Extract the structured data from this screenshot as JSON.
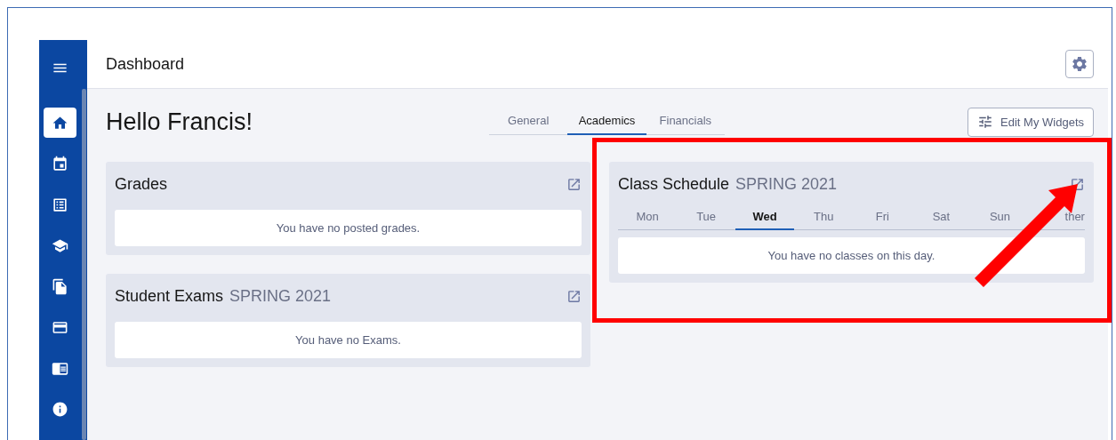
{
  "sidebar": {
    "menu": {
      "kind": "menu"
    },
    "items": [
      {
        "kind": "home",
        "selected": true
      },
      {
        "kind": "calendar",
        "selected": false
      },
      {
        "kind": "list",
        "selected": false
      },
      {
        "kind": "school",
        "selected": false
      },
      {
        "kind": "documents",
        "selected": false
      },
      {
        "kind": "card",
        "selected": false
      },
      {
        "kind": "book",
        "selected": false
      },
      {
        "kind": "info",
        "selected": false
      }
    ]
  },
  "header": {
    "title": "Dashboard"
  },
  "greeting": "Hello Francis!",
  "tabs": [
    {
      "label": "General",
      "selected": false
    },
    {
      "label": "Academics",
      "selected": true
    },
    {
      "label": "Financials",
      "selected": false
    }
  ],
  "edit_button": "Edit My Widgets",
  "left_widgets": [
    {
      "title": "Grades",
      "message": "You have no posted grades."
    },
    {
      "title": "Student Exams",
      "term": "SPRING 2021",
      "message": "You have no Exams."
    }
  ],
  "schedule": {
    "title": "Class Schedule",
    "term": "SPRING 2021",
    "days": [
      {
        "label": "Mon",
        "selected": false
      },
      {
        "label": "Tue",
        "selected": false
      },
      {
        "label": "Wed",
        "selected": true
      },
      {
        "label": "Thu",
        "selected": false
      },
      {
        "label": "Fri",
        "selected": false
      },
      {
        "label": "Sat",
        "selected": false
      },
      {
        "label": "Sun",
        "selected": false
      },
      {
        "label": "ther",
        "selected": false
      }
    ],
    "message": "You have no classes on this day."
  },
  "annotation": {
    "highlight": true,
    "arrow": true
  }
}
